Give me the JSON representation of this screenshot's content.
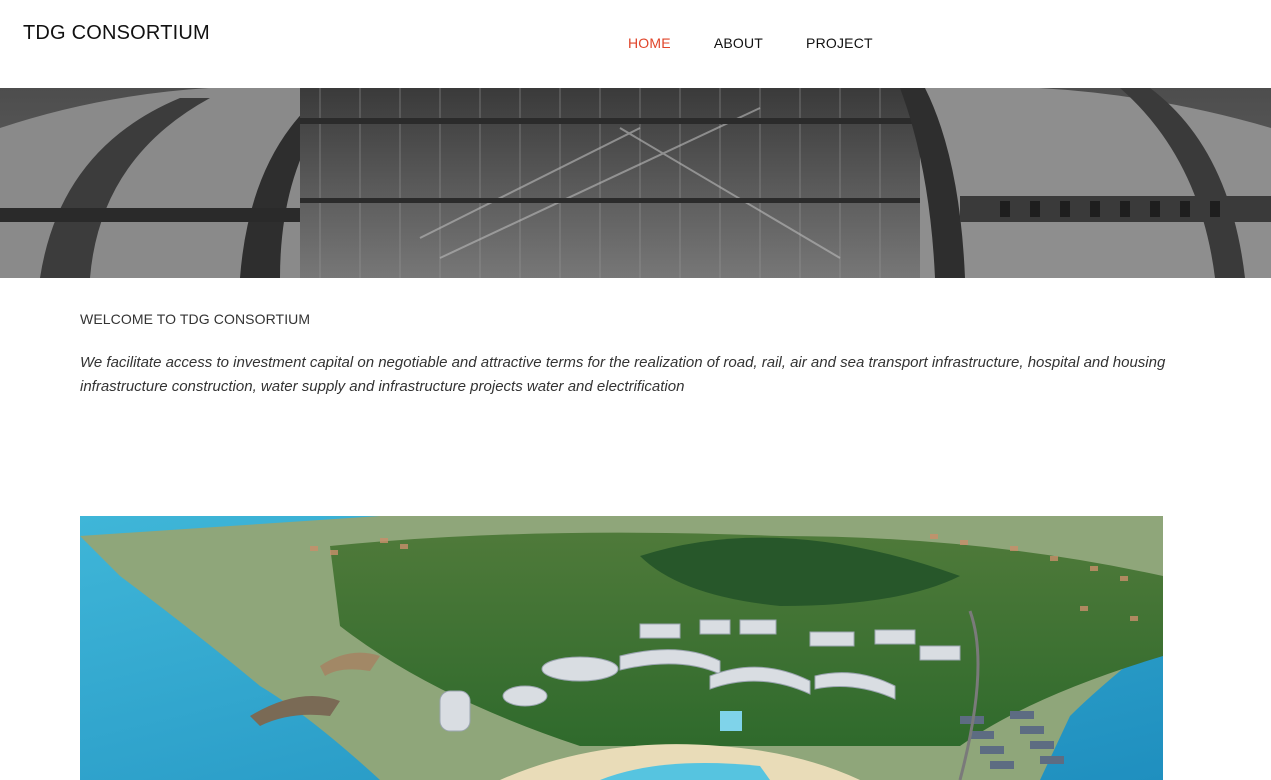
{
  "header": {
    "logo": "TDG CONSORTIUM",
    "nav": [
      {
        "label": "HOME",
        "active": true
      },
      {
        "label": "ABOUT",
        "active": false
      },
      {
        "label": "PROJECT",
        "active": false
      }
    ]
  },
  "intro": {
    "heading": "WELCOME TO TDG CONSORTIUM",
    "body": "We facilitate access to investment capital on negotiable and attractive terms for the realization of road, rail, air and sea transport infrastructure, hospital and housing infrastructure construction, water supply and infrastructure projects water and electrification"
  },
  "colors": {
    "accent": "#e0452a",
    "text": "#111111"
  }
}
